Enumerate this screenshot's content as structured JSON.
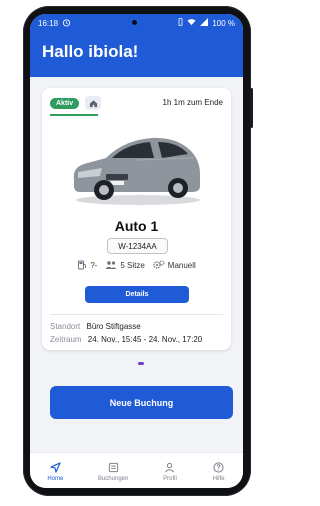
{
  "status_bar": {
    "time": "16:18",
    "alarm_icon": "alarm-icon",
    "battery": "100 %"
  },
  "header": {
    "title": "Hallo ibiola!"
  },
  "booking_card": {
    "status_badge": "Aktiv",
    "remaining": "1h 1m zum Ende",
    "car_name": "Auto 1",
    "plate": "W-1234AA",
    "specs": {
      "fuel": "?-",
      "seats": "5 Sitze",
      "transmission": "Manuell"
    },
    "details_label": "Details",
    "location_label": "Standort",
    "location_value": "Büro Stiftgasse",
    "period_label": "Zeitraum",
    "period_value": "24. Nov., 15:45 - 24. Nov., 17:20"
  },
  "primary_action": {
    "label": "Neue Buchung"
  },
  "bottom_nav": {
    "items": [
      {
        "label": "Home",
        "icon": "navigation-arrow-icon",
        "active": true
      },
      {
        "label": "Buchungen",
        "icon": "list-icon",
        "active": false
      },
      {
        "label": "Profil",
        "icon": "person-icon",
        "active": false
      },
      {
        "label": "Hilfe",
        "icon": "help-icon",
        "active": false
      }
    ]
  },
  "colors": {
    "primary": "#1f5bd6",
    "active_badge": "#2e9b5f",
    "background": "#f2f3f6"
  }
}
